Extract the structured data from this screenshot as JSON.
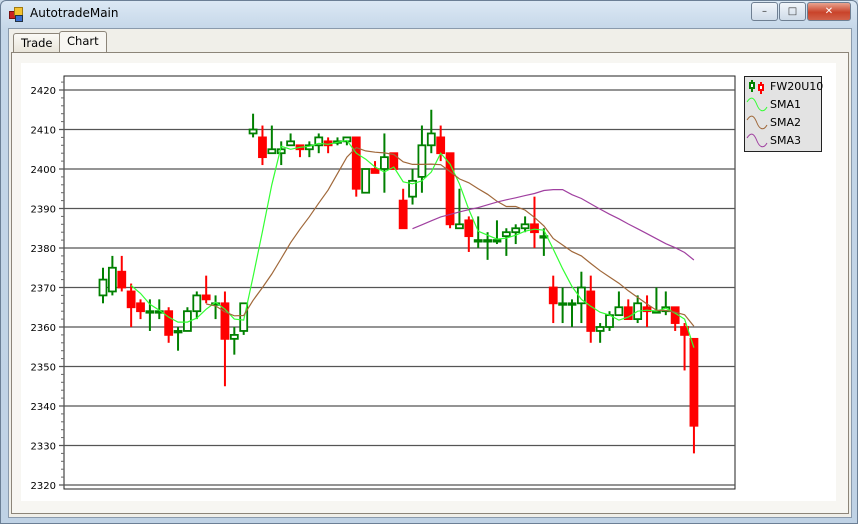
{
  "window": {
    "title": "AutotradeMain",
    "minimize": "–",
    "maximize": "□",
    "close": "✕"
  },
  "tabs": [
    {
      "label": "Trade",
      "active": false
    },
    {
      "label": "Chart",
      "active": true
    }
  ],
  "legend": [
    {
      "label": "FW20U10",
      "color": "#008000",
      "color2": "#ff0000",
      "kind": "candle"
    },
    {
      "label": "SMA1",
      "color": "#33ff33",
      "kind": "line"
    },
    {
      "label": "SMA2",
      "color": "#a0683a",
      "kind": "line"
    },
    {
      "label": "SMA3",
      "color": "#a040a0",
      "kind": "line"
    }
  ],
  "chart_data": {
    "type": "candlestick",
    "ylim": [
      2320,
      2423
    ],
    "yticks": [
      2320,
      2330,
      2340,
      2350,
      2360,
      2370,
      2380,
      2390,
      2400,
      2410,
      2420
    ],
    "grid": true,
    "legend_position": "right-top",
    "colors": {
      "up": "#008000",
      "down": "#ff0000"
    },
    "candles": [
      [
        2368,
        2375,
        2366,
        2372
      ],
      [
        2369,
        2378,
        2368,
        2375
      ],
      [
        2374,
        2378,
        2369,
        2370
      ],
      [
        2369,
        2371,
        2360,
        2365
      ],
      [
        2366,
        2367,
        2362,
        2364
      ],
      [
        2364,
        2367,
        2359,
        2364
      ],
      [
        2364,
        2367,
        2362,
        2364
      ],
      [
        2364,
        2365,
        2356,
        2358
      ],
      [
        2359,
        2360,
        2354,
        2359
      ],
      [
        2359,
        2365,
        2359,
        2364
      ],
      [
        2364,
        2369,
        2362,
        2368
      ],
      [
        2368,
        2373,
        2366,
        2367
      ],
      [
        2366,
        2368,
        2362,
        2366
      ],
      [
        2366,
        2369,
        2345,
        2357
      ],
      [
        2357,
        2360,
        2353,
        2358
      ],
      [
        2359,
        2366,
        2358,
        2366
      ],
      [
        2409,
        2414,
        2408,
        2410
      ],
      [
        2408,
        2411,
        2401,
        2403
      ],
      [
        2404,
        2411,
        2404,
        2405
      ],
      [
        2404,
        2407,
        2401,
        2405
      ],
      [
        2406,
        2409,
        2406,
        2407
      ],
      [
        2406,
        2406,
        2403,
        2405
      ],
      [
        2405,
        2407,
        2403,
        2406
      ],
      [
        2406,
        2409,
        2404,
        2408
      ],
      [
        2407,
        2408,
        2404,
        2406
      ],
      [
        2407,
        2408,
        2406,
        2407
      ],
      [
        2407,
        2408,
        2406,
        2408
      ],
      [
        2408,
        2408,
        2393,
        2395
      ],
      [
        2394,
        2400,
        2394,
        2400
      ],
      [
        2400,
        2402,
        2399,
        2399
      ],
      [
        2400,
        2409,
        2394,
        2403
      ],
      [
        2404,
        2404,
        2400,
        2400
      ],
      [
        2392,
        2395,
        2385,
        2385
      ],
      [
        2393,
        2400,
        2391,
        2397
      ],
      [
        2398,
        2411,
        2394,
        2406
      ],
      [
        2406,
        2415,
        2404,
        2409
      ],
      [
        2408,
        2411,
        2402,
        2404
      ],
      [
        2404,
        2404,
        2385,
        2386
      ],
      [
        2385,
        2395,
        2385,
        2386
      ],
      [
        2387,
        2388,
        2379,
        2383
      ],
      [
        2382,
        2388,
        2380,
        2382
      ],
      [
        2382,
        2384,
        2377,
        2382
      ],
      [
        2382,
        2387,
        2381,
        2382
      ],
      [
        2383,
        2385,
        2378,
        2384
      ],
      [
        2384,
        2386,
        2381,
        2385
      ],
      [
        2385,
        2388,
        2384,
        2386
      ],
      [
        2386,
        2393,
        2380,
        2384
      ],
      [
        2383,
        2385,
        2378,
        2383
      ],
      [
        2370,
        2373,
        2361,
        2366
      ],
      [
        2366,
        2370,
        2361,
        2366
      ],
      [
        2366,
        2367,
        2360,
        2366
      ],
      [
        2366,
        2374,
        2361,
        2370
      ],
      [
        2369,
        2373,
        2356,
        2359
      ],
      [
        2359,
        2361,
        2356,
        2360
      ],
      [
        2360,
        2364,
        2359,
        2363
      ],
      [
        2363,
        2369,
        2363,
        2365
      ],
      [
        2365,
        2367,
        2362,
        2362
      ],
      [
        2362,
        2368,
        2361,
        2366
      ],
      [
        2365,
        2368,
        2360,
        2364
      ],
      [
        2364,
        2370,
        2364,
        2364
      ],
      [
        2364,
        2369,
        2363,
        2365
      ],
      [
        2365,
        2365,
        2359,
        2361
      ],
      [
        2360,
        2361,
        2349,
        2358
      ],
      [
        2357,
        2357,
        2328,
        2335
      ]
    ],
    "sma": [
      {
        "name": "SMA1",
        "period": 4
      },
      {
        "name": "SMA2",
        "period": 12
      },
      {
        "name": "SMA3",
        "period": 34
      }
    ]
  }
}
